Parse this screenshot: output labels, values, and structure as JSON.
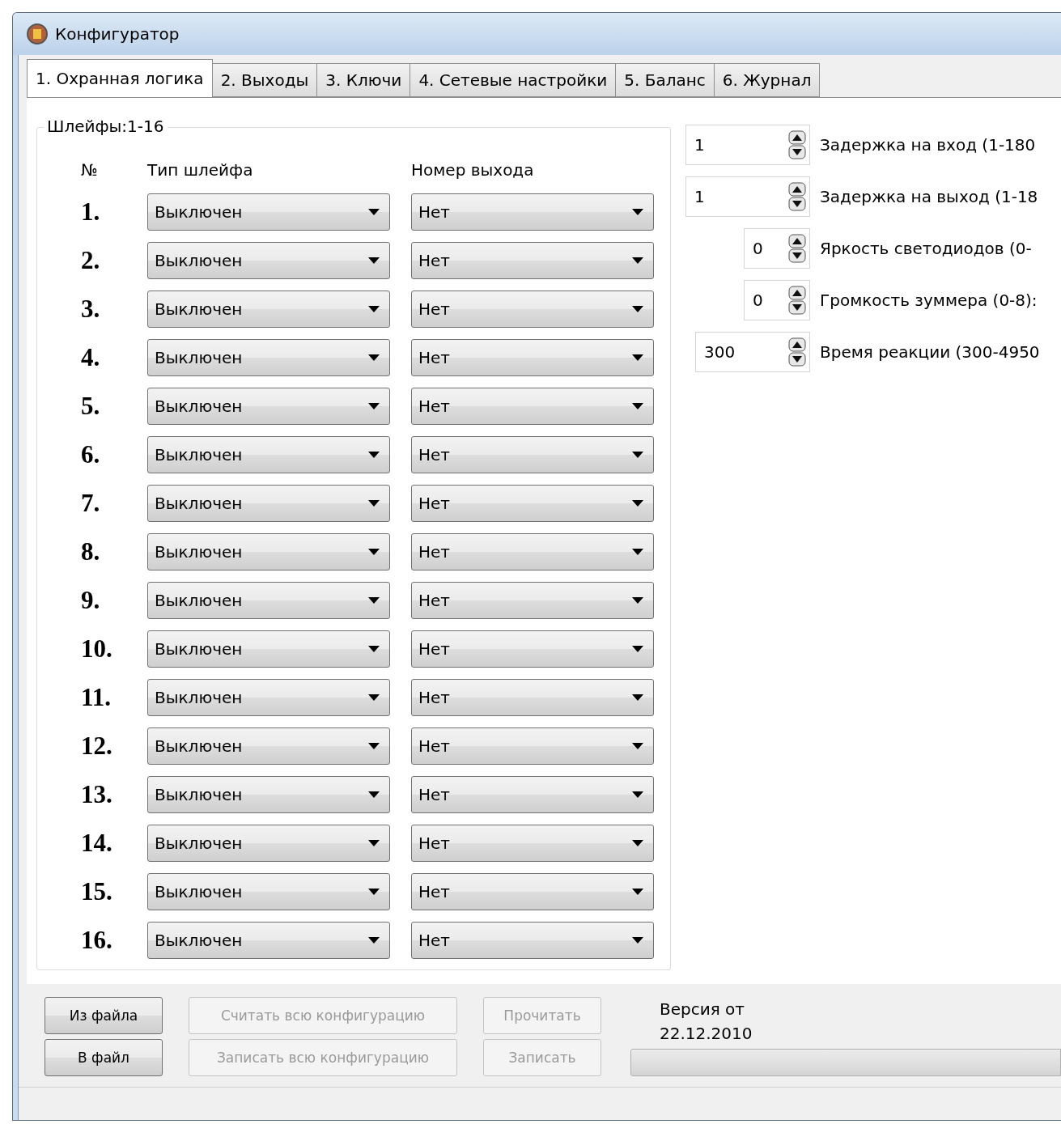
{
  "window": {
    "title": "Конфигуратор"
  },
  "tabs": [
    {
      "label": "1. Охранная логика",
      "selected": true
    },
    {
      "label": "2. Выходы",
      "selected": false
    },
    {
      "label": "3. Ключи",
      "selected": false
    },
    {
      "label": "4. Сетевые настройки",
      "selected": false
    },
    {
      "label": "5. Баланс",
      "selected": false
    },
    {
      "label": "6. Журнал",
      "selected": false
    }
  ],
  "loops": {
    "title": "Шлейфы:1-16",
    "columns": [
      "№",
      "Тип шлейфа",
      "Номер выхода"
    ],
    "rows": [
      {
        "number": "1.",
        "type": "Выключен",
        "output": "Нет"
      },
      {
        "number": "2.",
        "type": "Выключен",
        "output": "Нет"
      },
      {
        "number": "3.",
        "type": "Выключен",
        "output": "Нет"
      },
      {
        "number": "4.",
        "type": "Выключен",
        "output": "Нет"
      },
      {
        "number": "5.",
        "type": "Выключен",
        "output": "Нет"
      },
      {
        "number": "6.",
        "type": "Выключен",
        "output": "Нет"
      },
      {
        "number": "7.",
        "type": "Выключен",
        "output": "Нет"
      },
      {
        "number": "8.",
        "type": "Выключен",
        "output": "Нет"
      },
      {
        "number": "9.",
        "type": "Выключен",
        "output": "Нет"
      },
      {
        "number": "10.",
        "type": "Выключен",
        "output": "Нет"
      },
      {
        "number": "11.",
        "type": "Выключен",
        "output": "Нет"
      },
      {
        "number": "12.",
        "type": "Выключен",
        "output": "Нет"
      },
      {
        "number": "13.",
        "type": "Выключен",
        "output": "Нет"
      },
      {
        "number": "14.",
        "type": "Выключен",
        "output": "Нет"
      },
      {
        "number": "15.",
        "type": "Выключен",
        "output": "Нет"
      },
      {
        "number": "16.",
        "type": "Выключен",
        "output": "Нет"
      }
    ]
  },
  "settings": [
    {
      "kind": "wide",
      "value": "1",
      "label": "Задержка на вход (1-180"
    },
    {
      "kind": "wide",
      "value": "1",
      "label": "Задержка на выход (1-18"
    },
    {
      "kind": "narrow",
      "value": "0",
      "label": "Яркость светодиодов (0-"
    },
    {
      "kind": "narrow",
      "value": "0",
      "label": "Громкость зуммера (0-8):"
    },
    {
      "kind": "medium",
      "value": "300",
      "label": "Время реакции (300-4950"
    }
  ],
  "file_buttons": [
    {
      "label": "Из файла",
      "disabled": false
    },
    {
      "label": "В файл",
      "disabled": false
    }
  ],
  "config_buttons": [
    {
      "label": "Считать всю конфигурацию",
      "disabled": true
    },
    {
      "label": "Записать всю конфигурацию",
      "disabled": true
    }
  ],
  "device_buttons": [
    {
      "label": "Прочитать",
      "disabled": true
    },
    {
      "label": "Записать",
      "disabled": true
    }
  ],
  "version": [
    "Версия от",
    "22.12.2010"
  ],
  "progress": {
    "level": 0
  }
}
